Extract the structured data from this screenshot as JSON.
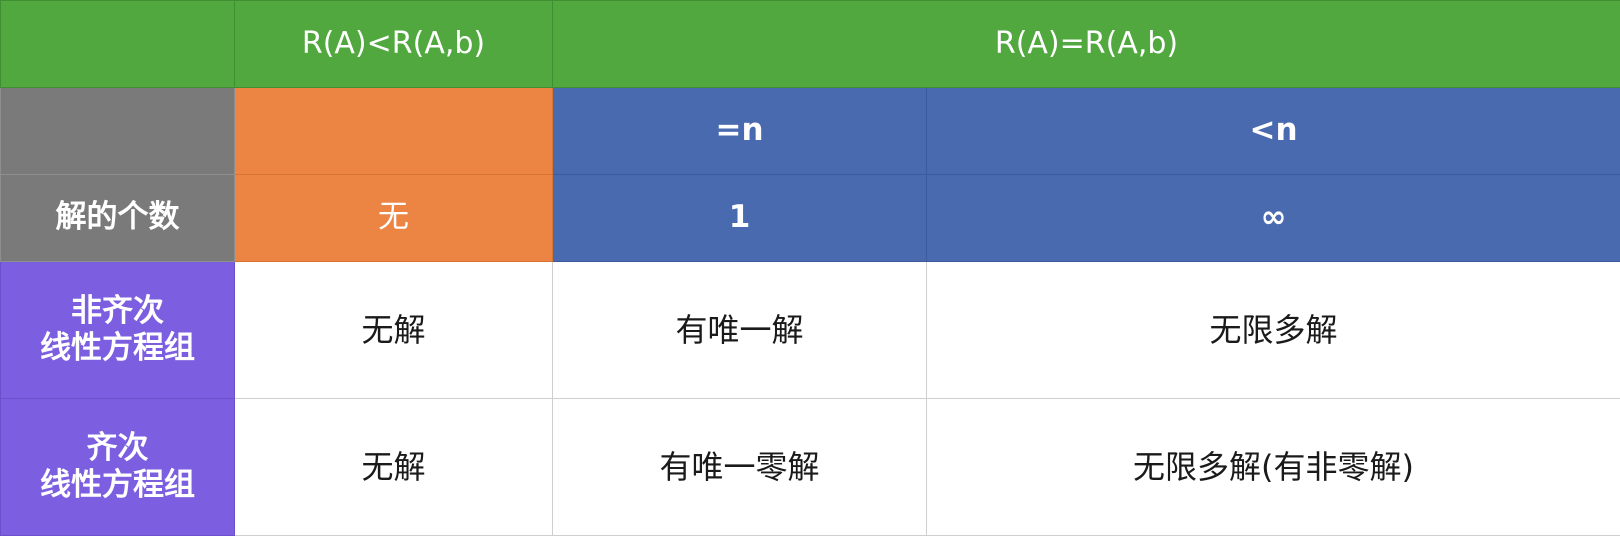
{
  "header": {
    "col_less": "R(A)<R(A,b)",
    "col_equal": "R(A)=R(A,b)"
  },
  "sub_header": {
    "eq_n": "=n",
    "lt_n": "<n"
  },
  "solution_count": {
    "row_label": "解的个数",
    "none": "无",
    "one": "1",
    "infinite": "∞"
  },
  "nonhomogeneous": {
    "label_line1": "非齐次",
    "label_line2": "线性方程组",
    "no_solution": "无解",
    "unique": "有唯一解",
    "infinite": "无限多解"
  },
  "homogeneous": {
    "label_line1": "齐次",
    "label_line2": "线性方程组",
    "no_solution": "无解",
    "unique": "有唯一零解",
    "infinite": "无限多解(有非零解)"
  },
  "colors": {
    "green": "#51a83f",
    "gray": "#7a7a7a",
    "orange": "#ec8443",
    "blue": "#4a6ab0",
    "purple": "#7c5fe0"
  }
}
